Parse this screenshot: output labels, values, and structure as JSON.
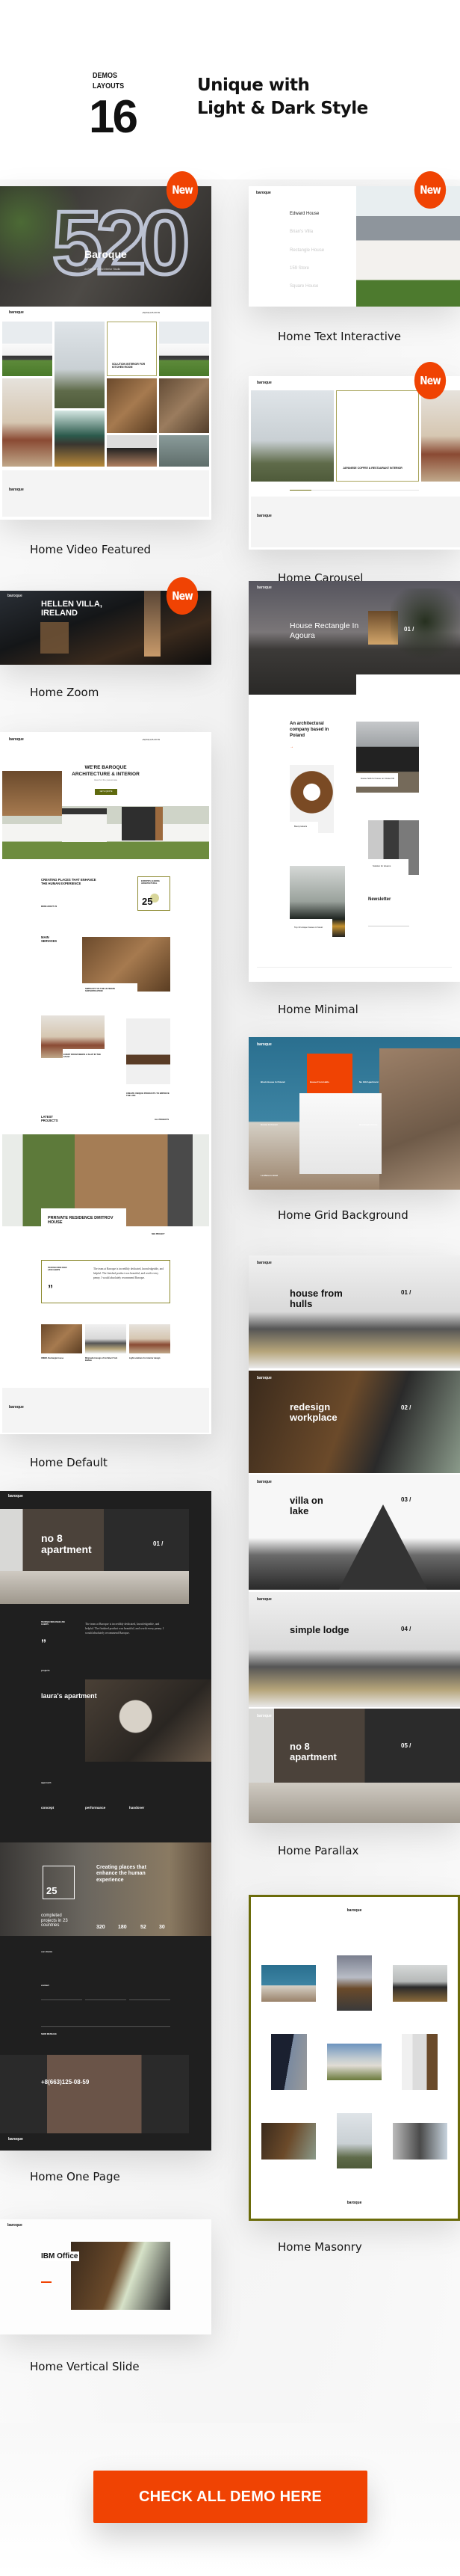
{
  "header": {
    "kicker_line1": "DEMOS",
    "kicker_line2": "LAYOUTS",
    "count": "16",
    "headline_line1": "Unique with",
    "headline_line2": "Light & Dark Style"
  },
  "badge_label": "New",
  "colors": {
    "accent": "#f04303",
    "olive": "#6b6b0a"
  },
  "demos": {
    "video_featured": {
      "label": "Home Video Featured",
      "hero_number": "520",
      "hero_title": "Baroque",
      "hero_sub": "Architecture and Interior Studio",
      "logo": "baroque",
      "phone": "+8(663)125-08-59",
      "box_title": "SOLUTION INTERIOR FOR KITCHEN ROOM"
    },
    "text_interactive": {
      "label": "Home Text Interactive",
      "logo": "baroque",
      "items": [
        "Edward House",
        "Brian's Villa",
        "Rectangle House",
        "159 Store",
        "Square House"
      ]
    },
    "carousel": {
      "label": "Home Carousel",
      "logo": "baroque",
      "box_title": "JAPANESE COFFEE & RESTAURANT INTERIOR"
    },
    "zoom": {
      "label": "Home Zoom",
      "logo": "baroque",
      "title": "HELLEN VILLA, IRELAND"
    },
    "default": {
      "label": "Home Default",
      "logo": "baroque",
      "phone": "+8(663)125-08-59",
      "hero_title_1": "WE'RE BAROQUE",
      "hero_title_2": "ARCHITECTURE & INTERIOR",
      "hero_sub": "Ideal for the passionate",
      "cta": "GET A QUOTE",
      "about_title": "CREATING PLACES THAT ENHANCE THE HUMAN EXPERIENCE",
      "about_link": "MORE ABOUT US",
      "years": "25",
      "years_label": "EUROPE'S LEADING ARCHITECTURAL",
      "services_title": "MAIN SERVICES",
      "service_1": "SIMPLICITY IN THE ULTIMATE SOPHISTICATION",
      "service_2": "EVERY ROOM NEEDS A SLAP IN THE FACE !",
      "service_3": "CREATE UNIQUE PRODUCTS TO IMPROVE THE LIFE",
      "latest_title": "LATEST PROJECTS",
      "all_projects": "ALL PROJECTS",
      "project_title": "PRRIVATE RESIDENCE DMITROV HOUSE",
      "see_project": "SEE PROJECT",
      "quote_kicker": "TRUSTED FROM OVER 2,500 CLIENTS",
      "quote": "The team at Baroque is incredibly dedicated, knowledgeable, and helpful. The finished product was beautiful, and worth every penny. I would absolutely recommend Baroque.",
      "posts": [
        "OMBR. Rectangle house",
        "Minimalist design of Architect York Buffalo",
        "Light solutions for interior design"
      ]
    },
    "minimal": {
      "label": "Home Minimal",
      "logo": "baroque",
      "hero_title": "House Rectangle In Agoura",
      "hero_index": "01 /",
      "intro": "An architectural company based in Poland",
      "card_1": "House hulls for house on Cruiser hill",
      "card_2": "Best products",
      "card_3": "Solution for dreams",
      "card_4": "Top 10 unique houses in forest",
      "newsletter": "Newsletter"
    },
    "grid_background": {
      "label": "Home Grid Background",
      "logo": "baroque",
      "tiles": [
        "Block House In Poland",
        "House From Hulls",
        "No 108 Apartment",
        "House In Forest",
        "Rectangle House",
        "La Maison Hotel"
      ]
    },
    "parallax": {
      "label": "Home Parallax",
      "logo": "baroque",
      "slides": [
        {
          "title": "house from hulls",
          "index": "01 /"
        },
        {
          "title": "redesign workplace",
          "index": "02 /"
        },
        {
          "title": "villa on lake",
          "index": "03 /"
        },
        {
          "title": "simple lodge",
          "index": "04 /"
        },
        {
          "title": "no 8 apartment",
          "index": "05 /"
        }
      ]
    },
    "one_page": {
      "label": "Home One Page",
      "logo": "baroque",
      "hero_title": "no 8 apartment",
      "hero_index": "01 /",
      "quote_kicker": "TRUSTED FROM OVER 2,500 CLIENTS",
      "quote": "The team at Baroque is incredibly dedicated, knowledgeable, and helpful. The finished product was beautiful, and worth every penny. I would absolutely recommend Baroque.",
      "projects": "projects",
      "project_title": "laura's apartment",
      "approach": "approach",
      "steps": [
        "concept",
        "performance",
        "handover"
      ],
      "creating": "Creating places that enhance the human experience",
      "years": "25",
      "completed": "completed projects in 23 countries",
      "stats": [
        "320",
        "180",
        "52",
        "30"
      ],
      "clients": "our clients",
      "contact": "contact",
      "send": "SEND MESSAGE",
      "phone": "+8(663)125-08-59"
    },
    "masonry": {
      "label": "Home Masonry",
      "logo": "baroque"
    },
    "vertical_slide": {
      "label": "Home Vertical Slide",
      "logo": "baroque",
      "title": "IBM Office"
    }
  },
  "cta": {
    "label": "CHECK ALL DEMO HERE"
  }
}
